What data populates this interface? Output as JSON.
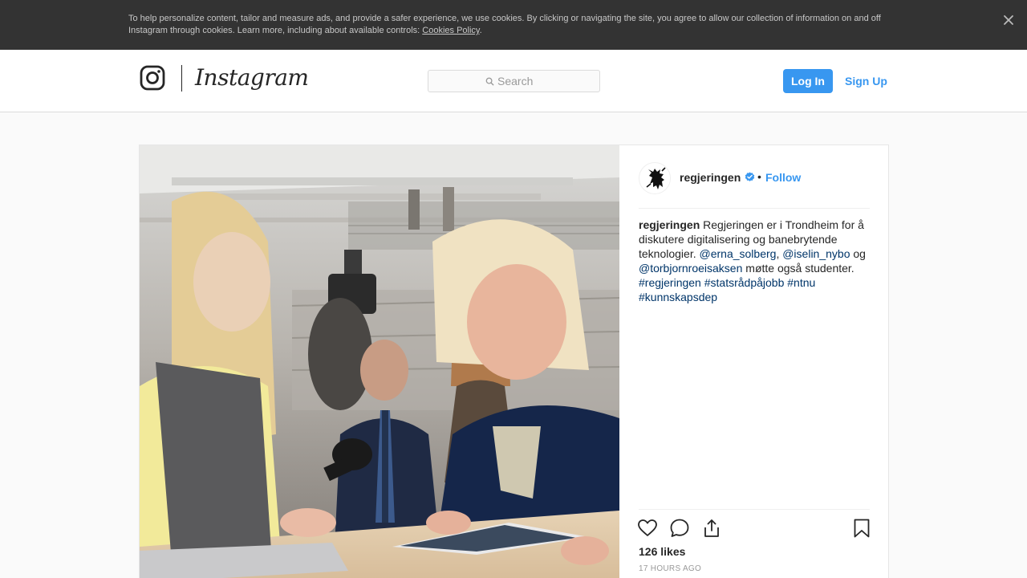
{
  "cookie_banner": {
    "text": "To help personalize content, tailor and measure ads, and provide a safer experience, we use cookies. By clicking or navigating the site, you agree to allow our collection of information on and off Instagram through cookies. Learn more, including about available controls: ",
    "link_text": "Cookies Policy",
    "trailing": ".",
    "close_icon": "close-icon"
  },
  "header": {
    "logo_text": "Instagram",
    "logo_icon": "instagram-camera-icon",
    "search": {
      "placeholder": "Search",
      "icon": "search-icon"
    },
    "login_label": "Log In",
    "signup_label": "Sign Up"
  },
  "post": {
    "image": "photo-people-at-laptop",
    "author": "regjeringen",
    "verified_icon": "verified-badge-icon",
    "separator": "•",
    "follow_label": "Follow",
    "caption": {
      "user": "regjeringen",
      "part1": " Regjeringen er i Trondheim for å diskutere digitalisering og banebrytende teknologier. ",
      "mention1": "@erna_solberg",
      "comma": ", ",
      "mention2": "@iselin_nybo",
      "og": " og ",
      "mention3": "@torbjornroeisaksen",
      "part2": " møtte også studenter. ",
      "tag1": "#regjeringen",
      "tag2": "#statsrådpåjobb",
      "tag3": "#ntnu",
      "tag4": "#kunnskapsdep"
    },
    "actions": [
      "heart-icon",
      "comment-icon",
      "share-icon",
      "bookmark-icon"
    ],
    "likes": "126 likes",
    "time_ago": "17 hours ago"
  },
  "colors": {
    "accent": "#3897f0",
    "link": "#003569",
    "banner": "#333333",
    "border": "#dbdbdb"
  }
}
